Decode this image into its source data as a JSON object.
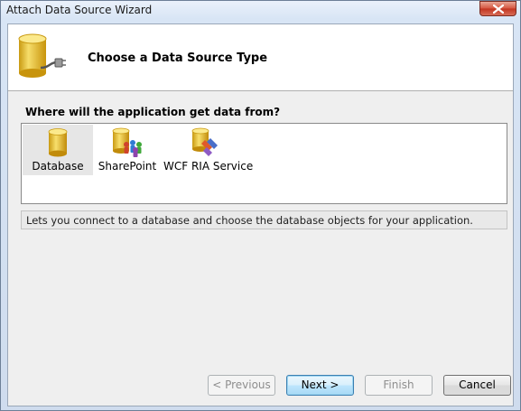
{
  "window": {
    "title": "Attach Data Source Wizard"
  },
  "header": {
    "title": "Choose a Data Source Type",
    "icon": "database-plug-icon"
  },
  "question": "Where will the application get data from?",
  "sources": [
    {
      "label": "Database",
      "icon": "database-icon",
      "selected": true
    },
    {
      "label": "SharePoint",
      "icon": "sharepoint-icon",
      "selected": false
    },
    {
      "label": "WCF RIA Service",
      "icon": "wcf-ria-service-icon",
      "selected": false
    }
  ],
  "description": "Lets you connect to a database and choose the database objects for your application.",
  "buttons": {
    "previous": "< Previous",
    "next": "Next >",
    "finish": "Finish",
    "cancel": "Cancel"
  },
  "colors": {
    "cylinder_gold": "#e8b923",
    "default_button_border": "#3c7fb1"
  }
}
